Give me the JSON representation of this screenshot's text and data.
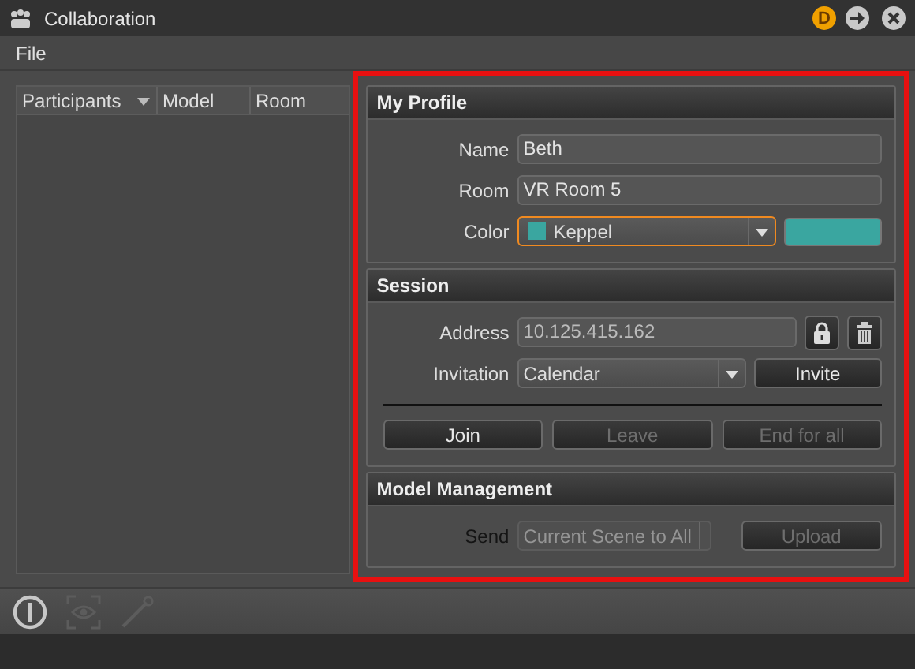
{
  "window": {
    "title": "Collaboration",
    "badge": "D"
  },
  "menu": [
    {
      "label": "File"
    }
  ],
  "table": {
    "columns": [
      {
        "label": "Participants",
        "sorted": true
      },
      {
        "label": "Model",
        "sorted": false
      },
      {
        "label": "Room",
        "sorted": false
      }
    ]
  },
  "highlighted": true,
  "profile": {
    "title": "My Profile",
    "fields": [
      {
        "kind": "text",
        "label": "Name",
        "value": "Beth"
      },
      {
        "kind": "text",
        "label": "Room",
        "value": "VR Room 5"
      },
      {
        "kind": "color",
        "label": "Color",
        "value": "Keppel",
        "color": "#3aa6a0",
        "focused": true
      }
    ]
  },
  "session": {
    "title": "Session",
    "address_label": "Address",
    "address": "10.125.415.162",
    "invitation_label": "Invitation",
    "invitation": "Calendar",
    "invite": {
      "label": "Invite",
      "disabled": false
    },
    "actions": [
      {
        "label": "Join",
        "disabled": false
      },
      {
        "label": "Leave",
        "disabled": true
      },
      {
        "label": "End for all",
        "disabled": true
      }
    ]
  },
  "model_management": {
    "title": "Model Management",
    "send_label": "Send",
    "send": "Current Scene to All",
    "disabled": true,
    "upload": {
      "label": "Upload",
      "disabled": true
    }
  },
  "toolbar": [
    {
      "kind": "power",
      "disabled": false
    },
    {
      "kind": "eye",
      "disabled": true
    },
    {
      "kind": "wand",
      "disabled": true
    }
  ]
}
